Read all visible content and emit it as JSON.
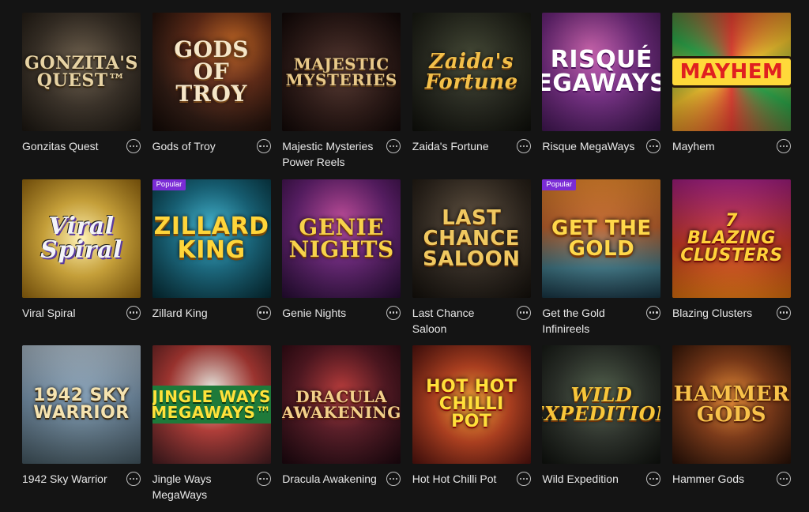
{
  "games": [
    {
      "name": "Gonzitas Quest",
      "art": "GONZITA'S QUEST™",
      "badge": ""
    },
    {
      "name": "Gods of Troy",
      "art": "GODS OF TROY",
      "badge": ""
    },
    {
      "name": "Majestic Mysteries Power Reels",
      "art": "MAJESTIC MYSTERIES",
      "badge": ""
    },
    {
      "name": "Zaida's Fortune",
      "art": "Zaida's Fortune",
      "badge": ""
    },
    {
      "name": "Risque MegaWays",
      "art": "RISQUÉ MEGAWAYS™",
      "badge": ""
    },
    {
      "name": "Mayhem",
      "art": "MAYHEM",
      "badge": ""
    },
    {
      "name": "Viral Spiral",
      "art": "Viral Spiral",
      "badge": ""
    },
    {
      "name": "Zillard King",
      "art": "ZILLARD KING",
      "badge": "Popular"
    },
    {
      "name": "Genie Nights",
      "art": "GENIE NIGHTS",
      "badge": ""
    },
    {
      "name": "Last Chance Saloon",
      "art": "LAST CHANCE SALOON",
      "badge": ""
    },
    {
      "name": "Get the Gold Infinireels",
      "art": "GET THE GOLD",
      "badge": "Popular"
    },
    {
      "name": "Blazing Clusters",
      "art": "7 BLAZING CLUSTERS",
      "badge": ""
    },
    {
      "name": "1942 Sky Warrior",
      "art": "1942 SKY WARRIOR",
      "badge": ""
    },
    {
      "name": "Jingle Ways MegaWays",
      "art": "JINGLE WAYS MEGAWAYS™",
      "badge": ""
    },
    {
      "name": "Dracula Awakening",
      "art": "DRACULA AWAKENING",
      "badge": ""
    },
    {
      "name": "Hot Hot Chilli Pot",
      "art": "HOT HOT CHILLI POT",
      "badge": ""
    },
    {
      "name": "Wild Expedition",
      "art": "WILD EXPEDITION",
      "badge": ""
    },
    {
      "name": "Hammer Gods",
      "art": "HAMMER GODS",
      "badge": ""
    }
  ]
}
